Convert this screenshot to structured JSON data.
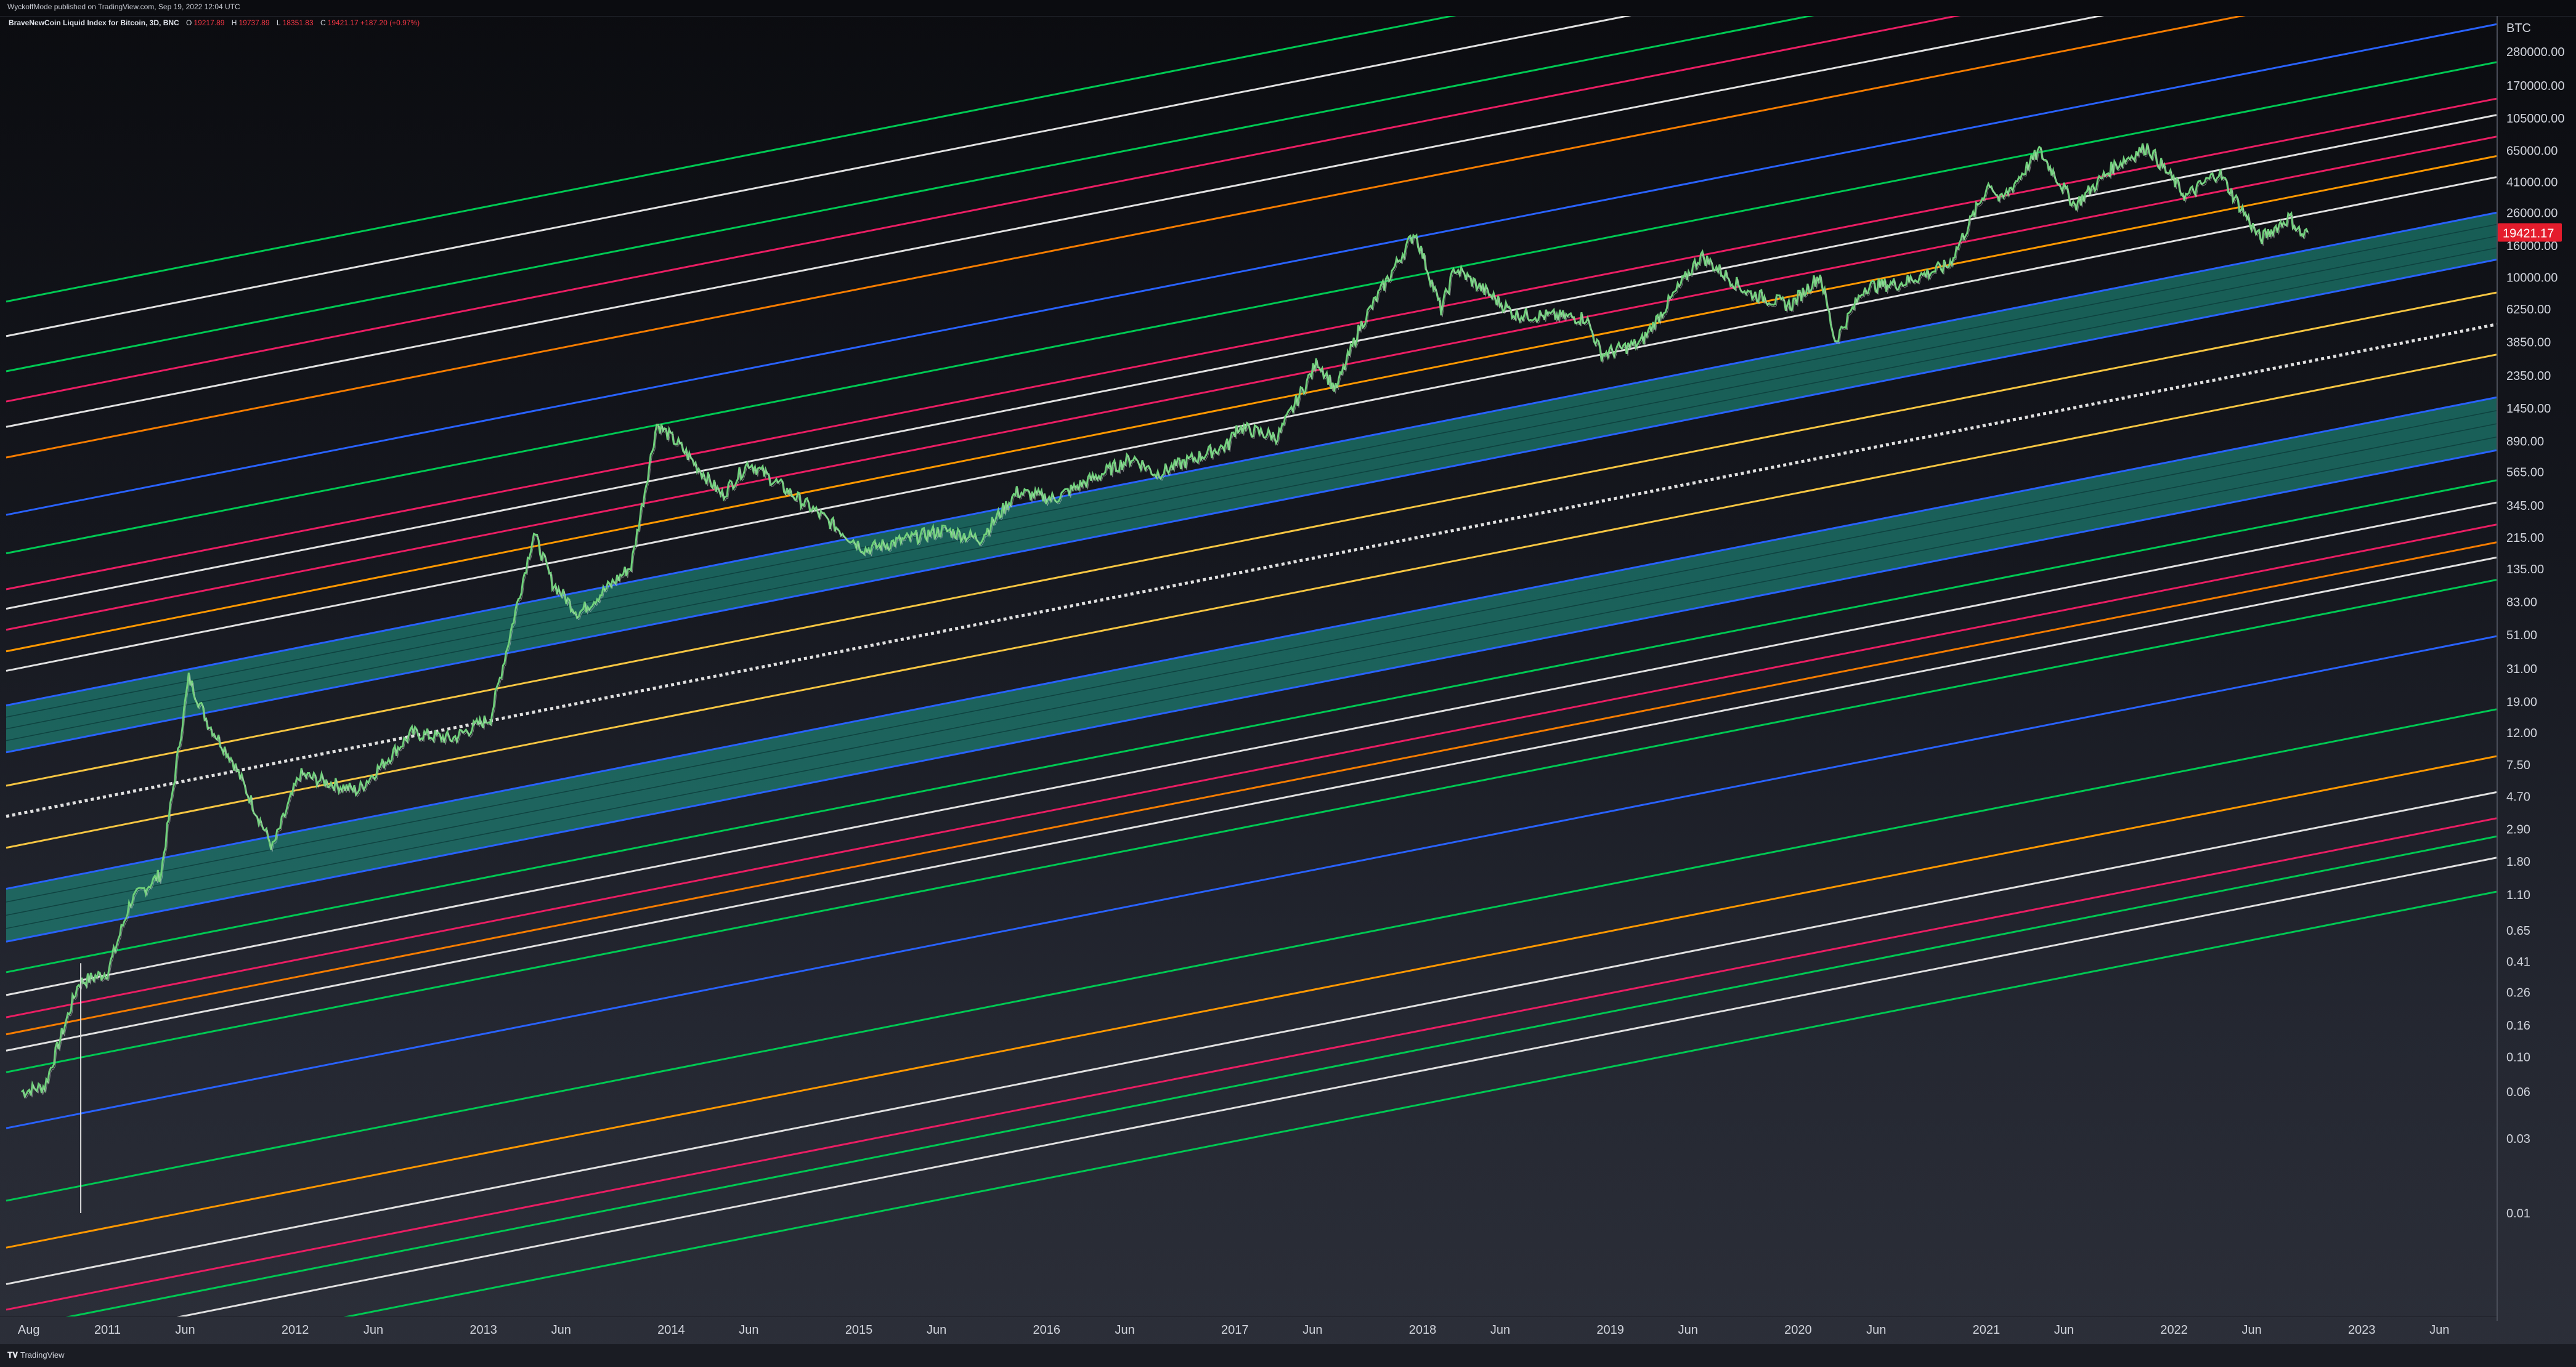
{
  "header": {
    "publisher": "WyckoffMode published on TradingView.com, Sep 19, 2022 12:04 UTC",
    "symbol": "BraveNewCoin Liquid Index for Bitcoin, 3D, BNC",
    "ohlc": [
      {
        "label": "O",
        "value": "19217.89"
      },
      {
        "label": "H",
        "value": "19737.89"
      },
      {
        "label": "L",
        "value": "18351.83"
      },
      {
        "label": "C",
        "value": "19421.17 +187.20 (+0.97%)"
      }
    ]
  },
  "footer": {
    "brand": "TradingView",
    "logo": "tradingview-logo-icon"
  },
  "colors": {
    "background_top": "#0b0c10",
    "background_bottom": "#2c2f39",
    "candle_up": "#6fcf7a",
    "candle_down": "#d8d8d8",
    "last_price_badge": "#e41c2c",
    "band_fill": "#1f9c8a",
    "band_edge": "#2962ff"
  },
  "chart_data": {
    "type": "line",
    "symbol": "BTC",
    "y_scale": "log",
    "y_unit": "BTC",
    "y_ticks": [
      "280000.00",
      "170000.00",
      "105000.00",
      "65000.00",
      "41000.00",
      "26000.00",
      "16000.00",
      "10000.00",
      "6250.00",
      "3850.00",
      "2350.00",
      "1450.00",
      "890.00",
      "565.00",
      "345.00",
      "215.00",
      "135.00",
      "83.00",
      "51.00",
      "31.00",
      "19.00",
      "12.00",
      "7.50",
      "4.70",
      "2.90",
      "1.80",
      "1.10",
      "0.65",
      "0.41",
      "0.26",
      "0.16",
      "0.10",
      "0.06",
      "0.03",
      "0.01"
    ],
    "x_ticks": [
      "Aug",
      "2011",
      "Jun",
      "2012",
      "Jun",
      "2013",
      "Jun",
      "2014",
      "Jun",
      "2015",
      "Jun",
      "2016",
      "Jun",
      "2017",
      "Jun",
      "2018",
      "Jun",
      "2019",
      "Jun",
      "2020",
      "Jun",
      "2021",
      "Jun",
      "2022",
      "Jun",
      "2023",
      "Jun"
    ],
    "last_price": "19421.17",
    "last_price_value": 19421.17,
    "grid": false,
    "legend": "none",
    "price_series": [
      {
        "date": "2010-07-18",
        "value": 0.06
      },
      {
        "date": "2010-09-01",
        "value": 0.065
      },
      {
        "date": "2010-11-06",
        "value": 0.3
      },
      {
        "date": "2011-01-01",
        "value": 0.35
      },
      {
        "date": "2011-02-15",
        "value": 1.0
      },
      {
        "date": "2011-04-15",
        "value": 1.5
      },
      {
        "date": "2011-06-08",
        "value": 27
      },
      {
        "date": "2011-07-15",
        "value": 14
      },
      {
        "date": "2011-09-01",
        "value": 8
      },
      {
        "date": "2011-11-18",
        "value": 2.2
      },
      {
        "date": "2012-01-10",
        "value": 6.5
      },
      {
        "date": "2012-05-01",
        "value": 5.1
      },
      {
        "date": "2012-08-15",
        "value": 12
      },
      {
        "date": "2012-11-01",
        "value": 11
      },
      {
        "date": "2013-01-15",
        "value": 15
      },
      {
        "date": "2013-04-09",
        "value": 230
      },
      {
        "date": "2013-05-15",
        "value": 110
      },
      {
        "date": "2013-07-05",
        "value": 70
      },
      {
        "date": "2013-10-15",
        "value": 140
      },
      {
        "date": "2013-12-04",
        "value": 1150
      },
      {
        "date": "2014-01-15",
        "value": 850
      },
      {
        "date": "2014-04-10",
        "value": 400
      },
      {
        "date": "2014-06-01",
        "value": 650
      },
      {
        "date": "2014-10-01",
        "value": 330
      },
      {
        "date": "2015-01-14",
        "value": 180
      },
      {
        "date": "2015-06-15",
        "value": 240
      },
      {
        "date": "2015-08-24",
        "value": 210
      },
      {
        "date": "2015-11-04",
        "value": 420
      },
      {
        "date": "2016-01-15",
        "value": 380
      },
      {
        "date": "2016-06-17",
        "value": 700
      },
      {
        "date": "2016-08-01",
        "value": 550
      },
      {
        "date": "2016-12-20",
        "value": 850
      },
      {
        "date": "2017-01-04",
        "value": 1100
      },
      {
        "date": "2017-03-25",
        "value": 950
      },
      {
        "date": "2017-06-11",
        "value": 2900
      },
      {
        "date": "2017-07-16",
        "value": 1900
      },
      {
        "date": "2017-09-01",
        "value": 4800
      },
      {
        "date": "2017-12-17",
        "value": 19500
      },
      {
        "date": "2018-02-06",
        "value": 6200
      },
      {
        "date": "2018-03-05",
        "value": 11500
      },
      {
        "date": "2018-06-30",
        "value": 5800
      },
      {
        "date": "2018-11-15",
        "value": 5500
      },
      {
        "date": "2018-12-15",
        "value": 3200
      },
      {
        "date": "2019-03-01",
        "value": 3800
      },
      {
        "date": "2019-06-26",
        "value": 13800
      },
      {
        "date": "2019-09-25",
        "value": 8000
      },
      {
        "date": "2019-12-17",
        "value": 6600
      },
      {
        "date": "2020-02-13",
        "value": 10400
      },
      {
        "date": "2020-03-13",
        "value": 3900
      },
      {
        "date": "2020-05-10",
        "value": 8700
      },
      {
        "date": "2020-07-20",
        "value": 9200
      },
      {
        "date": "2020-10-20",
        "value": 12000
      },
      {
        "date": "2021-01-08",
        "value": 41000
      },
      {
        "date": "2021-01-28",
        "value": 30500
      },
      {
        "date": "2021-04-14",
        "value": 64800
      },
      {
        "date": "2021-06-22",
        "value": 29000
      },
      {
        "date": "2021-09-07",
        "value": 52000
      },
      {
        "date": "2021-11-10",
        "value": 68900
      },
      {
        "date": "2022-01-24",
        "value": 33000
      },
      {
        "date": "2022-03-29",
        "value": 47400
      },
      {
        "date": "2022-05-11",
        "value": 28000
      },
      {
        "date": "2022-06-18",
        "value": 17600
      },
      {
        "date": "2022-08-14",
        "value": 24400
      },
      {
        "date": "2022-09-07",
        "value": 18600
      },
      {
        "date": "2022-09-18",
        "value": 19421.17
      }
    ],
    "trend_lines": [
      {
        "color": "#00c853",
        "y_start": 7000,
        "y_end": 10000000,
        "dash": false,
        "band": false
      },
      {
        "color": "#e0e0e0",
        "y_start": 4200,
        "y_end": 6000000,
        "dash": false,
        "band": false
      },
      {
        "color": "#00c853",
        "y_start": 2500,
        "y_end": 3500000,
        "dash": false,
        "band": false
      },
      {
        "color": "#e91e63",
        "y_start": 1600,
        "y_end": 2300000,
        "dash": false,
        "band": false
      },
      {
        "color": "#e0e0e0",
        "y_start": 1100,
        "y_end": 1500000,
        "dash": false,
        "band": false
      },
      {
        "color": "#f57c00",
        "y_start": 700,
        "y_end": 1000000,
        "dash": false,
        "band": false
      },
      {
        "color": "#2962ff",
        "y_start": 300,
        "y_end": 420000,
        "dash": false,
        "band": false
      },
      {
        "color": "#00c853",
        "y_start": 170,
        "y_end": 240000,
        "dash": false,
        "band": false
      },
      {
        "color": "#e91e63",
        "y_start": 100,
        "y_end": 140000,
        "dash": false,
        "band": false
      },
      {
        "color": "#e0e0e0",
        "y_start": 75,
        "y_end": 110000,
        "dash": false,
        "band": false
      },
      {
        "color": "#e91e63",
        "y_start": 55,
        "y_end": 80000,
        "dash": false,
        "band": false
      },
      {
        "color": "#ff9800",
        "y_start": 40,
        "y_end": 60000,
        "dash": false,
        "band": false
      },
      {
        "color": "#e0e0e0",
        "y_start": 30,
        "y_end": 44000,
        "dash": false,
        "band": false
      },
      {
        "color": "#2962ff",
        "y_start": 18,
        "y_end": 26000,
        "dash": false,
        "band": true,
        "band_to": 9
      },
      {
        "color": "#f5c542",
        "y_start": 5.5,
        "y_end": 8000,
        "dash": false,
        "band": false
      },
      {
        "color": "#e0e0e0",
        "y_start": 3.5,
        "y_end": 5000,
        "dash": true,
        "band": false
      },
      {
        "color": "#f5c542",
        "y_start": 2.2,
        "y_end": 3200,
        "dash": false,
        "band": false
      },
      {
        "color": "#2962ff",
        "y_start": 1.2,
        "y_end": 1700,
        "dash": false,
        "band": true,
        "band_to": 0.55
      },
      {
        "color": "#00c853",
        "y_start": 0.35,
        "y_end": 500,
        "dash": false,
        "band": false
      },
      {
        "color": "#e0e0e0",
        "y_start": 0.25,
        "y_end": 360,
        "dash": false,
        "band": false
      },
      {
        "color": "#e91e63",
        "y_start": 0.18,
        "y_end": 260,
        "dash": false,
        "band": false
      },
      {
        "color": "#f57c00",
        "y_start": 0.14,
        "y_end": 200,
        "dash": false,
        "band": false
      },
      {
        "color": "#e0e0e0",
        "y_start": 0.11,
        "y_end": 160,
        "dash": false,
        "band": false
      },
      {
        "color": "#00c853",
        "y_start": 0.08,
        "y_end": 115,
        "dash": false,
        "band": false
      },
      {
        "color": "#2962ff",
        "y_start": 0.035,
        "y_end": 50,
        "dash": false,
        "band": false
      },
      {
        "color": "#00c853",
        "y_start": 0.012,
        "y_end": 17,
        "dash": false,
        "band": false
      },
      {
        "color": "#ff9800",
        "y_start": 0.006,
        "y_end": 8.5,
        "dash": false,
        "band": false
      },
      {
        "color": "#e0e0e0",
        "y_start": 0.0035,
        "y_end": 5,
        "dash": false,
        "band": false
      },
      {
        "color": "#e91e63",
        "y_start": 0.0024,
        "y_end": 3.4,
        "dash": false,
        "band": false
      },
      {
        "color": "#00c853",
        "y_start": 0.0018,
        "y_end": 2.6,
        "dash": false,
        "band": false
      },
      {
        "color": "#e0e0e0",
        "y_start": 0.0013,
        "y_end": 1.9,
        "dash": false,
        "band": false
      },
      {
        "color": "#00c853",
        "y_start": 0.0008,
        "y_end": 1.15,
        "dash": false,
        "band": false
      }
    ]
  }
}
